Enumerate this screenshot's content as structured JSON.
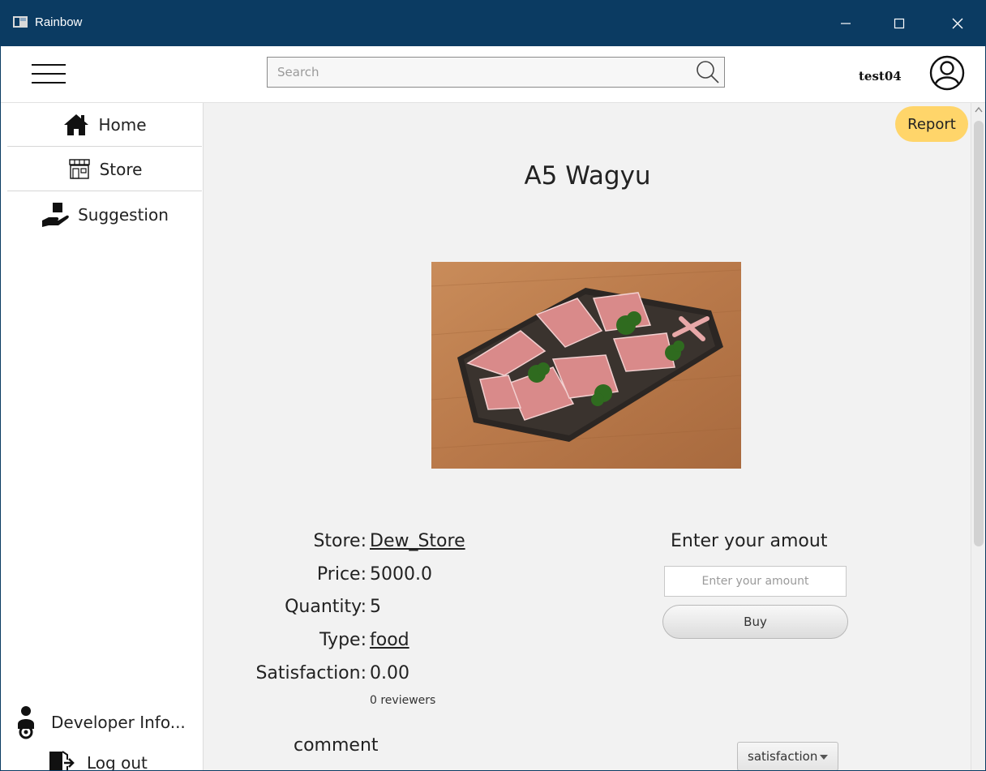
{
  "window": {
    "title": "Rainbow"
  },
  "topbar": {
    "search_placeholder": "Search",
    "username": "test04"
  },
  "sidebar": {
    "items": [
      {
        "label": "Home",
        "icon": "home-icon"
      },
      {
        "label": "Store",
        "icon": "store-icon"
      },
      {
        "label": "Suggestion",
        "icon": "hand-gift-icon"
      }
    ],
    "developer_info": "Developer Info...",
    "logout": "Log out"
  },
  "main": {
    "report_label": "Report",
    "product_title": "A5 Wagyu",
    "details": {
      "store_label": "Store:",
      "store_value": "Dew_Store",
      "price_label": "Price:",
      "price_value": "5000.0",
      "quantity_label": "Quantity:",
      "quantity_value": "5",
      "type_label": "Type:",
      "type_value": "food",
      "satisfaction_label": "Satisfaction:",
      "satisfaction_value": "0.00",
      "reviewers": "0 reviewers"
    },
    "purchase": {
      "title": "Enter your amout",
      "input_placeholder": "Enter your amount",
      "buy_label": "Buy"
    },
    "comment_label": "comment",
    "sort_select_value": "satisfaction"
  },
  "colors": {
    "titlebar": "#0b3b62",
    "report_button": "#ffd56a",
    "background": "#f2f2f2"
  }
}
